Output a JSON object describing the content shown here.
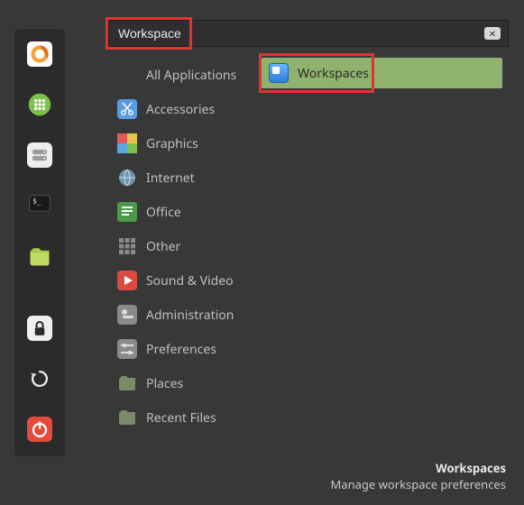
{
  "search": {
    "value": "Workspace"
  },
  "categories": [
    {
      "id": "all",
      "label": "All Applications"
    },
    {
      "id": "accessories",
      "label": "Accessories"
    },
    {
      "id": "graphics",
      "label": "Graphics"
    },
    {
      "id": "internet",
      "label": "Internet"
    },
    {
      "id": "office",
      "label": "Office"
    },
    {
      "id": "other",
      "label": "Other"
    },
    {
      "id": "sound-video",
      "label": "Sound & Video"
    },
    {
      "id": "administration",
      "label": "Administration"
    },
    {
      "id": "preferences",
      "label": "Preferences"
    },
    {
      "id": "places",
      "label": "Places"
    },
    {
      "id": "recent",
      "label": "Recent Files"
    }
  ],
  "results": [
    {
      "id": "workspaces",
      "label": "Workspaces"
    }
  ],
  "footer": {
    "title": "Workspaces",
    "subtitle": "Manage workspace preferences"
  },
  "taskbar": [
    "firefox",
    "phone",
    "disks",
    "terminal",
    "files",
    "lock",
    "update",
    "shutdown"
  ]
}
